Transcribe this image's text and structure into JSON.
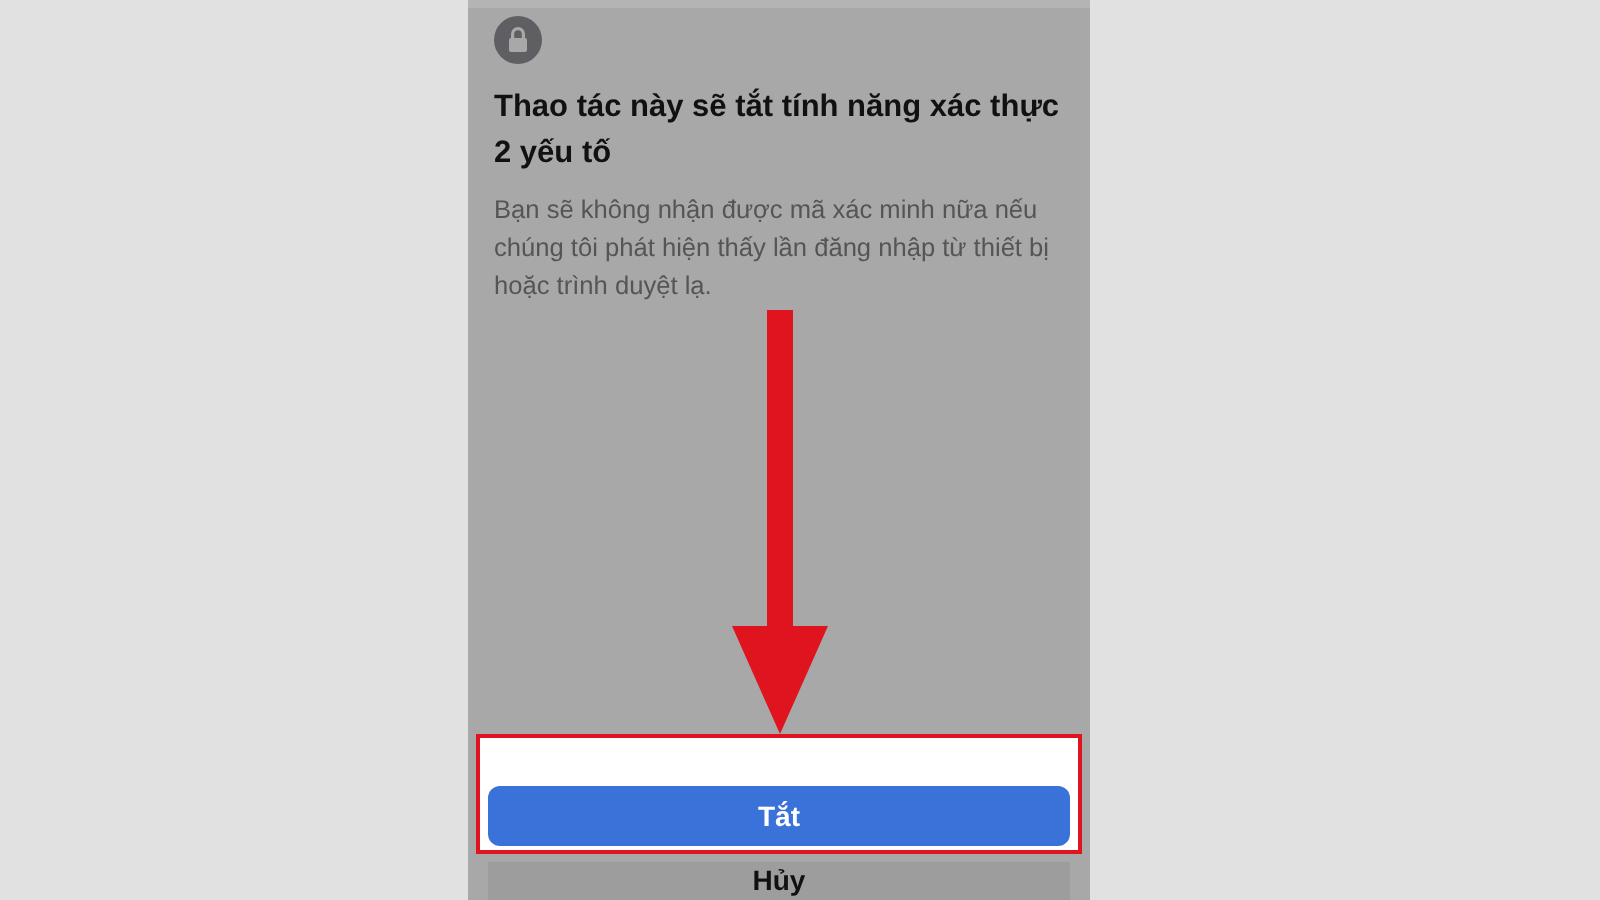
{
  "title": "Thao tác này sẽ tắt tính năng xác thực 2 yếu tố",
  "message": "Bạn sẽ không nhận được mã xác minh nữa nếu chúng tôi phát hiện thấy lần đăng nhập từ thiết bị hoặc trình duyệt lạ.",
  "buttons": [
    {
      "label": "Tắt",
      "kind": "primary",
      "highlighted": true
    },
    {
      "label": "Hủy",
      "kind": "secondary",
      "highlighted": false
    }
  ]
}
